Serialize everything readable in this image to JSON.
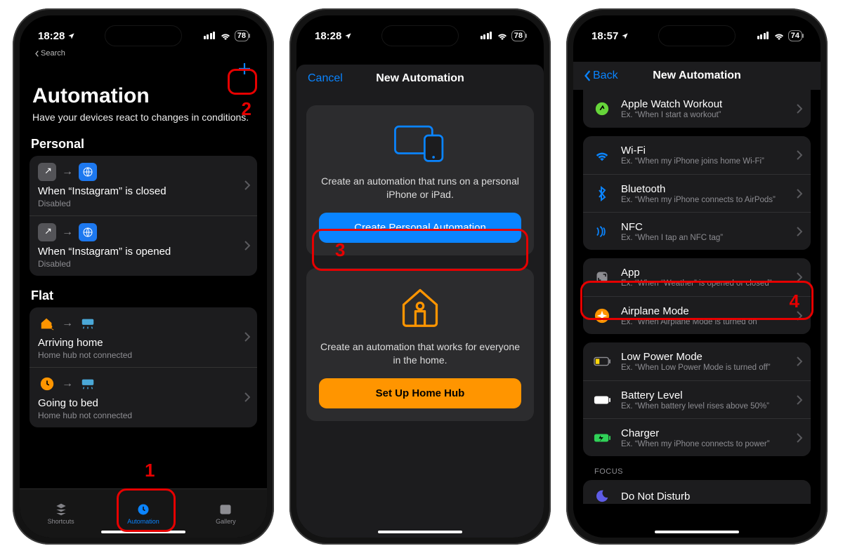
{
  "screen1": {
    "time": "18:28",
    "battery": "78",
    "breadcrumb": "Search",
    "title": "Automation",
    "subtitle": "Have your devices react to changes in conditions.",
    "sections": {
      "personal": {
        "header": "Personal",
        "items": [
          {
            "title": "When “Instagram” is closed",
            "subtitle": "Disabled"
          },
          {
            "title": "When “Instagram” is opened",
            "subtitle": "Disabled"
          }
        ]
      },
      "flat": {
        "header": "Flat",
        "items": [
          {
            "title": "Arriving home",
            "subtitle": "Home hub not connected"
          },
          {
            "title": "Going to bed",
            "subtitle": "Home hub not connected"
          }
        ]
      }
    },
    "tabs": [
      "Shortcuts",
      "Automation",
      "Gallery"
    ]
  },
  "screen2": {
    "time": "18:28",
    "battery": "78",
    "nav": {
      "left": "Cancel",
      "title": "New Automation"
    },
    "personal": {
      "text": "Create an automation that runs on a personal iPhone or iPad.",
      "button": "Create Personal Automation"
    },
    "home": {
      "text": "Create an automation that works for everyone in the home.",
      "button": "Set Up Home Hub"
    }
  },
  "screen3": {
    "time": "18:57",
    "battery": "74",
    "nav": {
      "left": "Back",
      "title": "New Automation"
    },
    "groups": [
      {
        "partial_top": {
          "title": "Apple Watch Workout",
          "desc": "Ex. “When I start a workout”"
        }
      },
      {
        "items": [
          {
            "icon": "wifi",
            "title": "Wi-Fi",
            "desc": "Ex. “When my iPhone joins home Wi-Fi”"
          },
          {
            "icon": "bluetooth",
            "title": "Bluetooth",
            "desc": "Ex. “When my iPhone connects to AirPods”"
          },
          {
            "icon": "nfc",
            "title": "NFC",
            "desc": "Ex. “When I tap an NFC tag”"
          }
        ]
      },
      {
        "items": [
          {
            "icon": "app",
            "title": "App",
            "desc": "Ex. “When “Weather” is opened or closed”"
          },
          {
            "icon": "airplane",
            "title": "Airplane Mode",
            "desc": "Ex. “When Airplane Mode is turned on”"
          }
        ]
      },
      {
        "items": [
          {
            "icon": "lowpower",
            "title": "Low Power Mode",
            "desc": "Ex. “When Low Power Mode is turned off”"
          },
          {
            "icon": "battery",
            "title": "Battery Level",
            "desc": "Ex. “When battery level rises above 50%”"
          },
          {
            "icon": "charger",
            "title": "Charger",
            "desc": "Ex. “When my iPhone connects to power”"
          }
        ]
      }
    ],
    "focus_header": "FOCUS",
    "focus_item": "Do Not Disturb"
  },
  "annotations": {
    "1": "1",
    "2": "2",
    "3": "3",
    "4": "4"
  }
}
